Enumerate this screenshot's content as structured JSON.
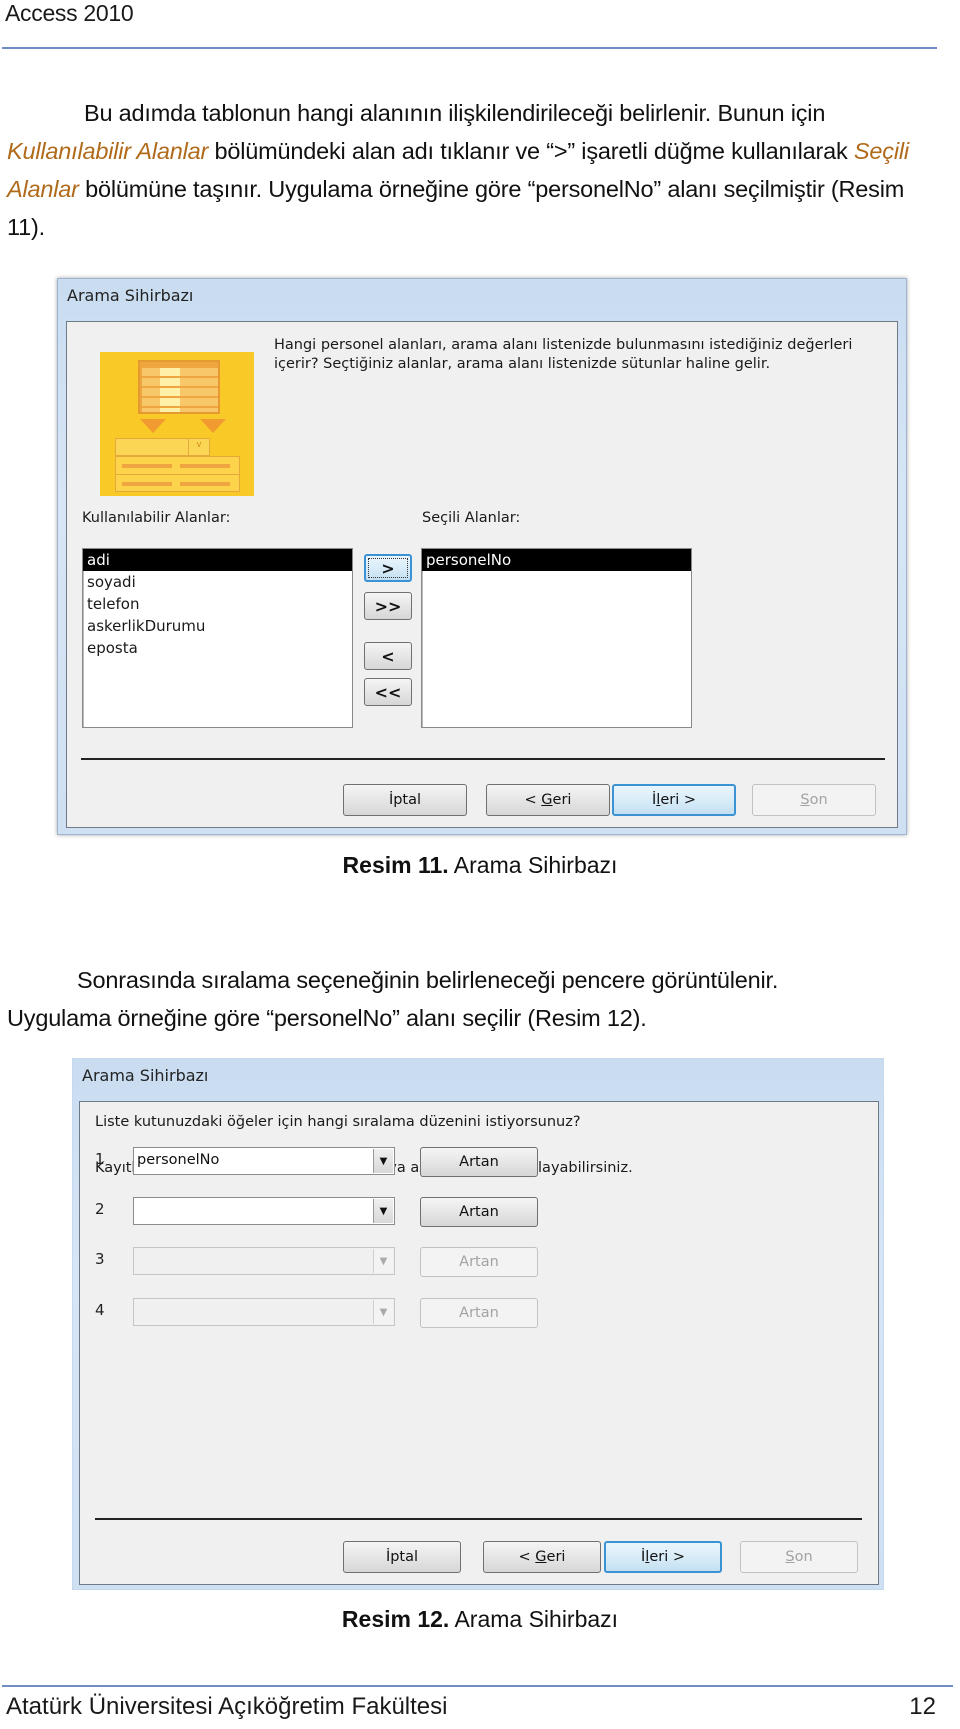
{
  "header": {
    "title": "Access 2010"
  },
  "paragraph1": {
    "part1": "Bu adımda tablonun hangi alanının ilişkilendirileceği belirlenir. Bunun için",
    "highlight1": "Kullanılabilir Alanlar",
    "part2": " bölümündeki alan adı tıklanır ve “>” işaretli düğme kullanılarak ",
    "highlight2": "Seçili Alanlar",
    "part3": " bölümüne taşınır. Uygulama örneğine göre “personelNo” alanı seçilmiştir (Resim 11)."
  },
  "dialog1": {
    "title": "Arama Sihirbazı",
    "instruction_line1": "Hangi personel alanları, arama alanı listenizde bulunmasını istediğiniz değerleri",
    "instruction_line2": "içerir? Seçtiğiniz alanlar, arama alanı listenizde sütunlar haline gelir.",
    "available_label": "Kullanılabilir Alanlar:",
    "available_fields": [
      {
        "label": "adi",
        "selected": true
      },
      {
        "label": "soyadi",
        "selected": false
      },
      {
        "label": "telefon",
        "selected": false
      },
      {
        "label": "askerlikDurumu",
        "selected": false
      },
      {
        "label": "eposta",
        "selected": false
      }
    ],
    "selected_label": "Seçili Alanlar:",
    "selected_fields": [
      {
        "label": "personelNo",
        "selected": true
      }
    ],
    "move_buttons": {
      "add_one": ">",
      "add_all": ">>",
      "remove_one": "<",
      "remove_all": "<<"
    },
    "footer_buttons": {
      "cancel": "İptal",
      "back_prefix": "< ",
      "back_accel": "G",
      "back_rest": "eri",
      "next_prefix": "İ",
      "next_accel": "l",
      "next_rest": "eri >",
      "finish_accel": "S",
      "finish_rest": "on"
    }
  },
  "caption1": {
    "bold": "Resim 11.",
    "text": " Arama Sihirbazı"
  },
  "paragraph2": {
    "line1": "Sonrasında sıralama seçeneğinin belirleneceği pencere görüntülenir.",
    "line2": "Uygulama örneğine göre “personelNo” alanı seçilir (Resim 12)."
  },
  "dialog2": {
    "title": "Arama Sihirbazı",
    "question": "Liste kutunuzdaki öğeler için hangi sıralama düzenini istiyorsunuz?",
    "hint": "Kayıtları en çok dört alana göre artan veya azalan sırada sıralayabilirsiniz.",
    "sort_rows": [
      {
        "number": "1",
        "value": "personelNo",
        "order": "Artan",
        "enabled": true
      },
      {
        "number": "2",
        "value": "",
        "order": "Artan",
        "enabled": true
      },
      {
        "number": "3",
        "value": "",
        "order": "Artan",
        "enabled": false
      },
      {
        "number": "4",
        "value": "",
        "order": "Artan",
        "enabled": false
      }
    ],
    "footer_buttons": {
      "cancel": "İptal",
      "back_prefix": "< ",
      "back_accel": "G",
      "back_rest": "eri",
      "next_prefix": "İ",
      "next_accel": "l",
      "next_rest": "eri >",
      "finish_accel": "S",
      "finish_rest": "on"
    }
  },
  "caption2": {
    "bold": "Resim 12.",
    "text": " Arama Sihirbazı"
  },
  "footer": {
    "institution": "Atatürk Üniversitesi Açıköğretim Fakültesi",
    "page_number": "12"
  },
  "colors": {
    "header_rule": "#6f8fc4",
    "highlight_text": "#b06a1a",
    "focus_border": "#3c93d4"
  }
}
